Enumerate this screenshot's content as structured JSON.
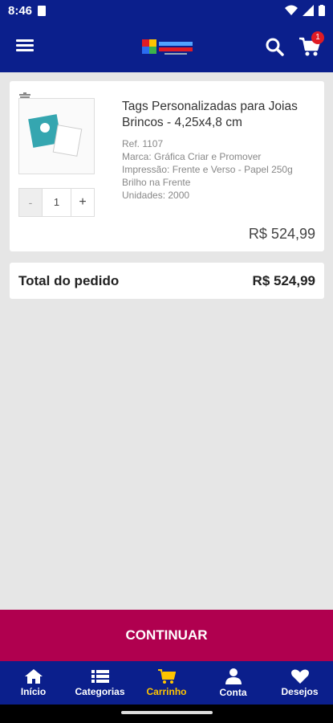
{
  "status": {
    "time": "8:46"
  },
  "header": {
    "cart_count": "1"
  },
  "cart": {
    "item": {
      "title": "Tags Personalizadas para Joias Brincos - 4,25x4,8 cm",
      "ref": "Ref. 1107",
      "brand": "Marca: Gráfica Criar e Promover",
      "print": "Impressão: Frente e Verso - Papel 250g Brilho na Frente",
      "units": "Unidades: 2000",
      "quantity": "1",
      "minus_label": "-",
      "plus_label": "+",
      "price": "R$ 524,99"
    },
    "total_label": "Total do pedido",
    "total_value": "R$ 524,99"
  },
  "continue_label": "CONTINUAR",
  "nav": {
    "items": [
      {
        "label": "Início",
        "icon": "home-icon"
      },
      {
        "label": "Categorias",
        "icon": "list-icon"
      },
      {
        "label": "Carrinho",
        "icon": "cart-icon"
      },
      {
        "label": "Conta",
        "icon": "user-icon"
      },
      {
        "label": "Desejos",
        "icon": "heart-icon"
      }
    ],
    "active_color": "#ffc400"
  },
  "colors": {
    "primary": "#0b1f8c",
    "accent": "#b0004f",
    "badge": "#e01b24"
  }
}
